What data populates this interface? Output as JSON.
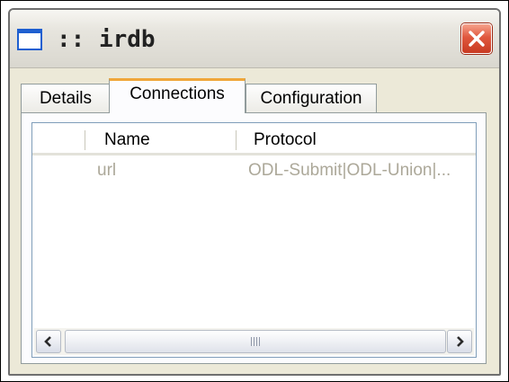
{
  "window": {
    "title": ":: irdb",
    "icon": "window-icon",
    "close_icon": "close-icon"
  },
  "tabs": [
    {
      "label": "Details",
      "active": false
    },
    {
      "label": "Connections",
      "active": true
    },
    {
      "label": "Configuration",
      "active": false
    }
  ],
  "table": {
    "columns": [
      "Name",
      "Protocol"
    ],
    "rows": [
      {
        "name": "url",
        "protocol": "ODL-Submit|ODL-Union|..."
      }
    ]
  },
  "scrollbar": {
    "left_icon": "chevron-left-icon",
    "right_icon": "chevron-right-icon",
    "grip_icon": "grip-icon"
  },
  "colors": {
    "close_button": "#d4472d",
    "active_tab_accent": "#f0a73a",
    "disabled_text": "#aca899",
    "list_border": "#7f9db9"
  }
}
